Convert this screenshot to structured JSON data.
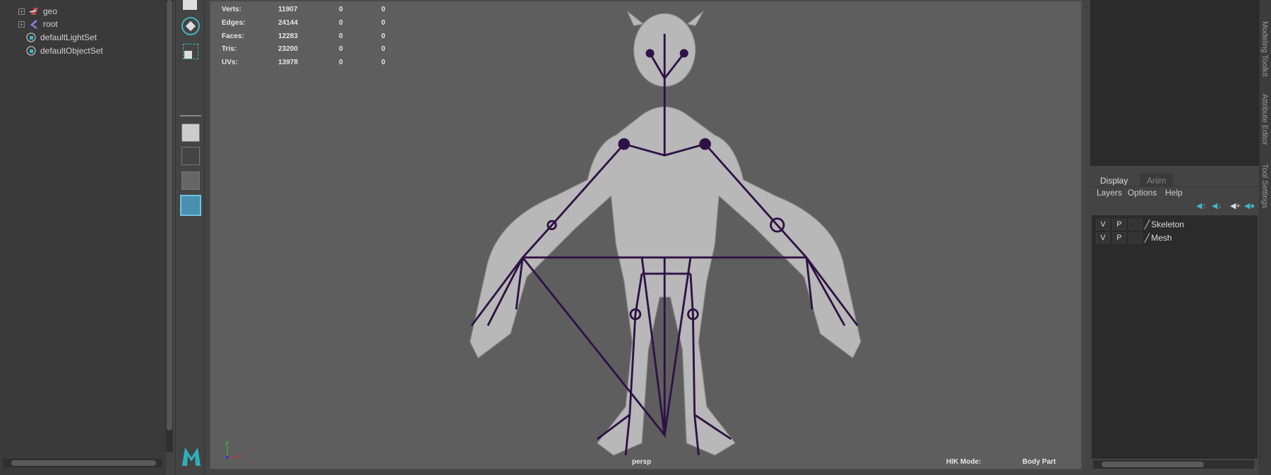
{
  "outliner": {
    "items": [
      {
        "label": "geo",
        "icon": "transform-group-icon",
        "expandable": true
      },
      {
        "label": "root",
        "icon": "joint-icon",
        "expandable": true
      },
      {
        "label": "defaultLightSet",
        "icon": "set-icon",
        "expandable": false
      },
      {
        "label": "defaultObjectSet",
        "icon": "set-icon",
        "expandable": false
      }
    ]
  },
  "viewport": {
    "stats": [
      {
        "label": "Verts:",
        "value": "11907",
        "sel": "0",
        "comp": "0"
      },
      {
        "label": "Edges:",
        "value": "24144",
        "sel": "0",
        "comp": "0"
      },
      {
        "label": "Faces:",
        "value": "12283",
        "sel": "0",
        "comp": "0"
      },
      {
        "label": "Tris:",
        "value": "23200",
        "sel": "0",
        "comp": "0"
      },
      {
        "label": "UVs:",
        "value": "13978",
        "sel": "0",
        "comp": "0"
      }
    ],
    "camera": "persp",
    "hik_label": "HIK Mode:",
    "hik_value": "Body Part",
    "axis": {
      "x": "x",
      "y": "y"
    },
    "skeleton_color": "#2e1245"
  },
  "layer_editor": {
    "tabs": [
      "Display",
      "Anim"
    ],
    "menu": [
      "Layers",
      "Options",
      "Help"
    ],
    "layers": [
      {
        "v": "V",
        "p": "P",
        "name": "Skeleton"
      },
      {
        "v": "V",
        "p": "P",
        "name": "Mesh"
      }
    ]
  },
  "side_tabs": [
    "Modeling Toolkit",
    "Attribute Editor",
    "Tool Settings"
  ],
  "accent": "#3fb6c2"
}
